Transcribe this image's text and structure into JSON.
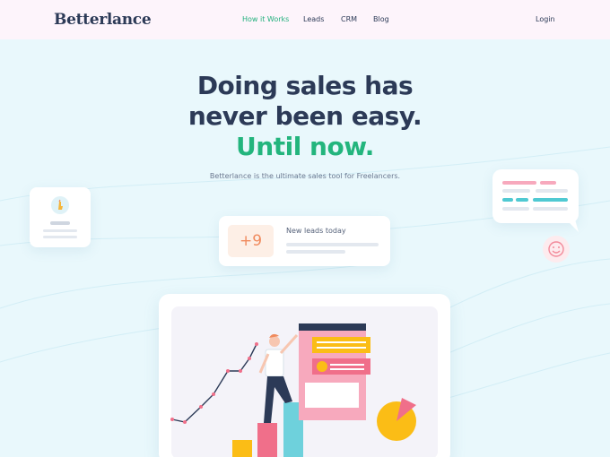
{
  "nav": {
    "logo": "Betterlance",
    "links": [
      "How it Works",
      "Leads",
      "CRM",
      "Blog"
    ],
    "login": "Login"
  },
  "hero": {
    "title_line1": "Doing sales has",
    "title_line2": "never been easy.",
    "title_accent": "Until now.",
    "subtitle": "Betterlance is the ultimate sales tool for Freelancers."
  },
  "leads_card": {
    "count": "+9",
    "label": "New leads today"
  },
  "colors": {
    "accent_green": "#23b57d",
    "navy": "#2c3a57",
    "nav_bg": "#fdf4fb",
    "page_bg": "#e9f8fc",
    "orange_badge": "#f08a5d"
  },
  "icons": [
    "hand-pointer-icon",
    "smiley-icon",
    "chat-bubble-icon"
  ]
}
